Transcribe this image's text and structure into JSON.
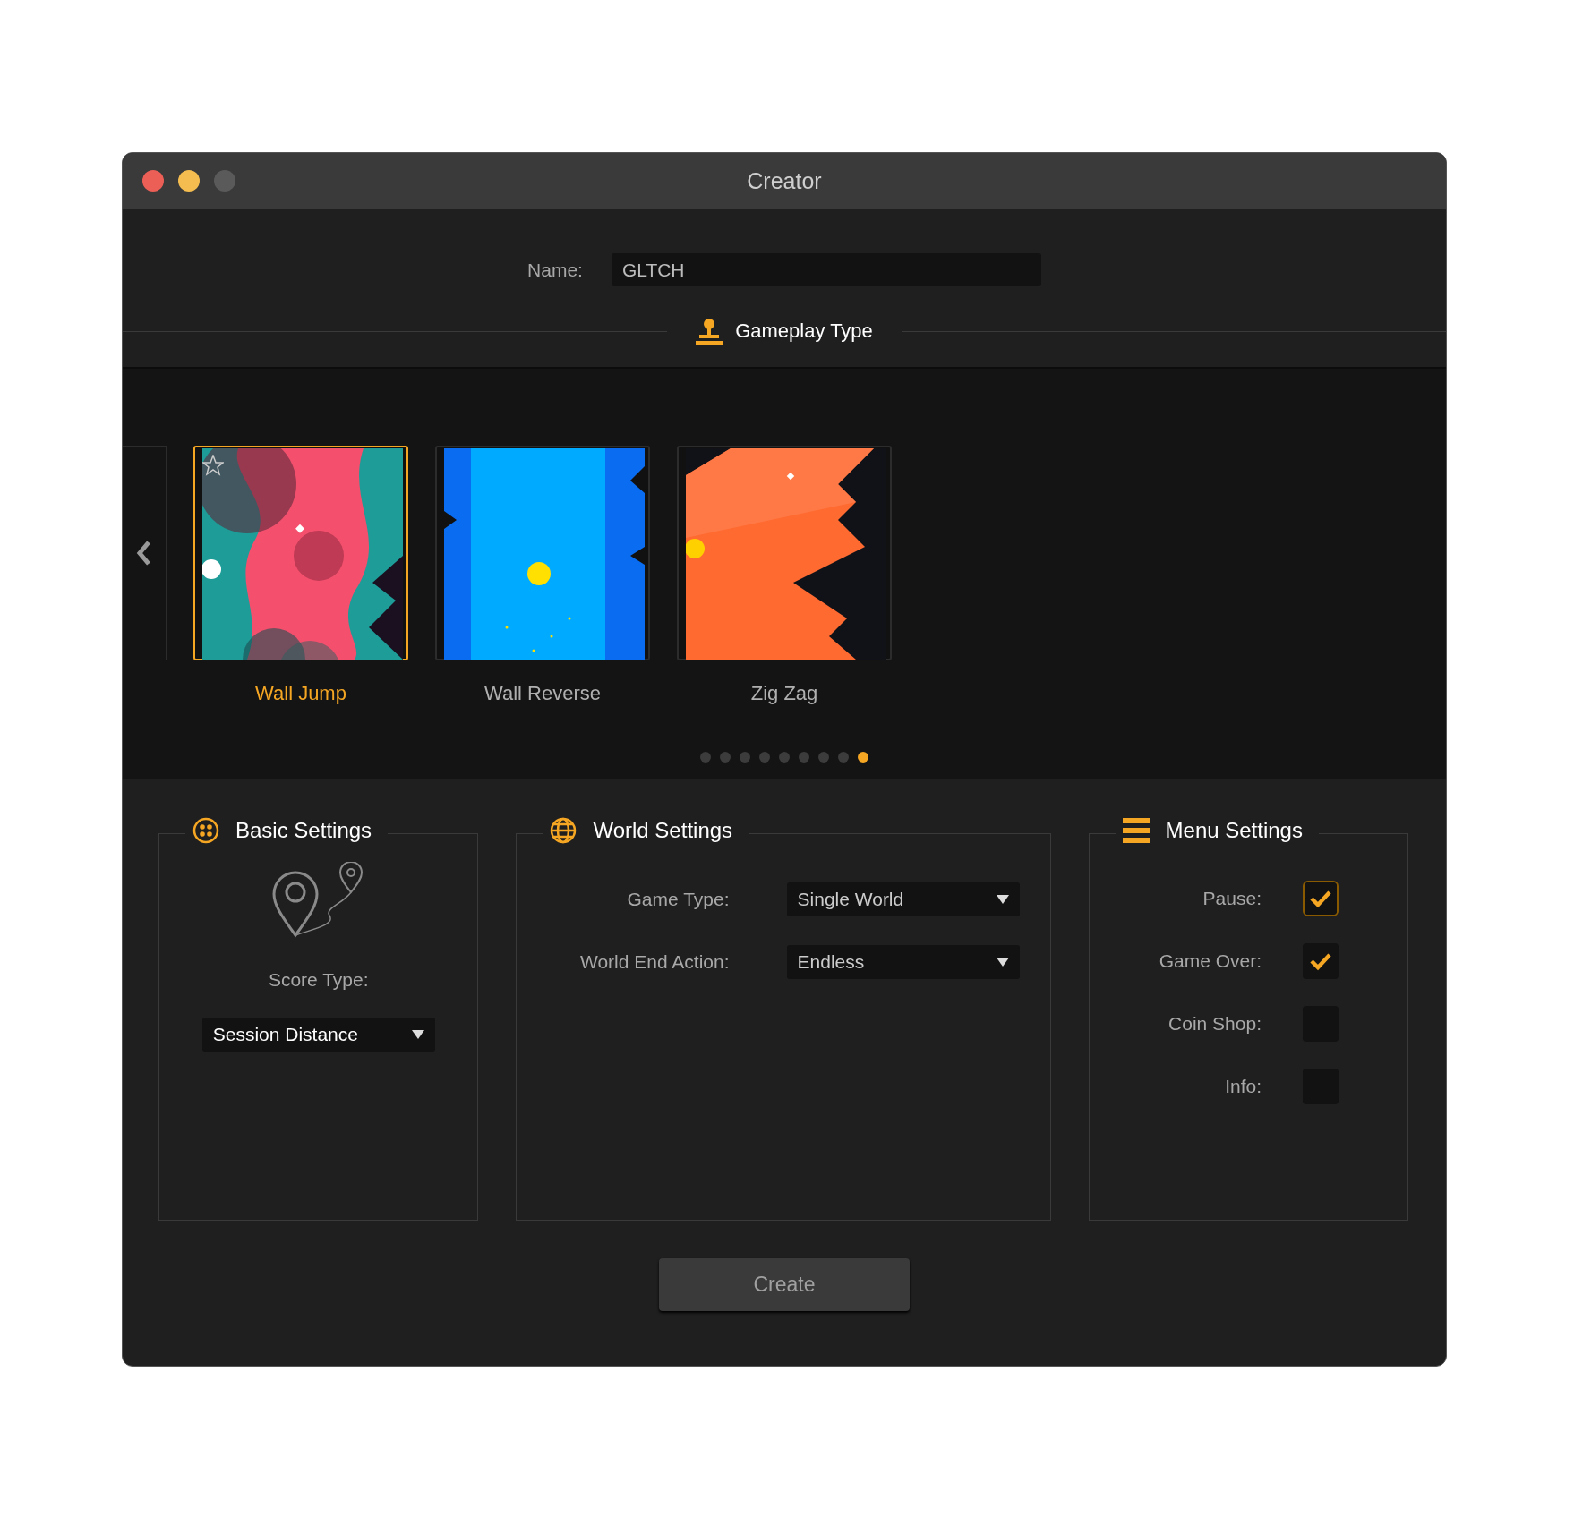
{
  "window": {
    "title": "Creator"
  },
  "name_field": {
    "label": "Name:",
    "value": "GLTCH"
  },
  "gameplay_type": {
    "title": "Gameplay Type",
    "cards": [
      {
        "label": "Wall Jump",
        "selected": true,
        "starred": true
      },
      {
        "label": "Wall Reverse",
        "selected": false,
        "starred": false
      },
      {
        "label": "Zig Zag",
        "selected": false,
        "starred": false
      }
    ],
    "page_dots": [
      {
        "selected": false
      },
      {
        "selected": false
      },
      {
        "selected": false
      },
      {
        "selected": false
      },
      {
        "selected": false
      },
      {
        "selected": false
      },
      {
        "selected": false
      },
      {
        "selected": false
      },
      {
        "selected": true
      }
    ]
  },
  "basic_settings": {
    "title": "Basic Settings",
    "score_type": {
      "label": "Score Type:",
      "value": "Session Distance"
    }
  },
  "world_settings": {
    "title": "World Settings",
    "fields": [
      {
        "label": "Game Type:",
        "value": "Single World"
      },
      {
        "label": "World End Action:",
        "value": "Endless"
      }
    ]
  },
  "menu_settings": {
    "title": "Menu Settings",
    "options": [
      {
        "label": "Pause:",
        "checked": true,
        "focused": true
      },
      {
        "label": "Game Over:",
        "checked": true,
        "focused": false
      },
      {
        "label": "Coin Shop:",
        "checked": false,
        "focused": false
      },
      {
        "label": "Info:",
        "checked": false,
        "focused": false
      }
    ]
  },
  "create_button": {
    "label": "Create"
  }
}
